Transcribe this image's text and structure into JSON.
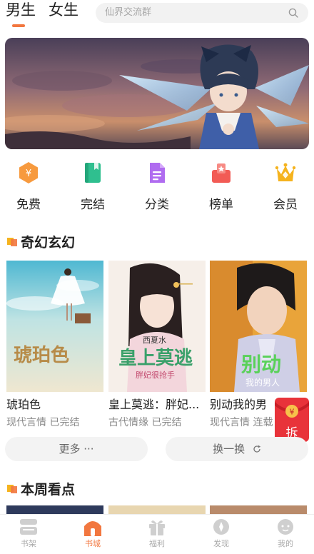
{
  "header": {
    "tabs": [
      {
        "label": "男生",
        "active": true
      },
      {
        "label": "女生",
        "active": false
      }
    ],
    "search": {
      "placeholder": "仙界交流群"
    }
  },
  "quick_links": [
    {
      "label": "免费",
      "icon": "coin-hex-icon",
      "color": "#f79a3e"
    },
    {
      "label": "完结",
      "icon": "book-icon",
      "color": "#2fbf8f"
    },
    {
      "label": "分类",
      "icon": "document-icon",
      "color": "#b06cf0"
    },
    {
      "label": "榜单",
      "icon": "ranking-icon",
      "color": "#f25b55"
    },
    {
      "label": "会员",
      "icon": "crown-icon",
      "color": "#f5b31e"
    }
  ],
  "sections": [
    {
      "title": "奇幻玄幻",
      "books": [
        {
          "title": "琥珀色",
          "meta": "现代言情 已完结",
          "cover_text": "琥珀色"
        },
        {
          "title": "皇上莫逃：胖妃...",
          "meta": "古代情缘 已完结",
          "cover_text": "皇上莫逃",
          "cover_author": "西夏水",
          "cover_sub": "胖妃很抢手"
        },
        {
          "title": "别动我的男",
          "meta": "现代言情 连载",
          "cover_text": "别动",
          "cover_sub": "我的男人"
        }
      ],
      "more_label": "更多 ···",
      "refresh_label": "换一换"
    },
    {
      "title": "本周看点"
    }
  ],
  "float_badge": {
    "label": "拆"
  },
  "bottom_nav": [
    {
      "label": "书架",
      "icon": "bookshelf-icon",
      "active": false
    },
    {
      "label": "书城",
      "icon": "bookstore-icon",
      "active": true
    },
    {
      "label": "福利",
      "icon": "gift-icon",
      "active": false
    },
    {
      "label": "发现",
      "icon": "discover-icon",
      "active": false
    },
    {
      "label": "我的",
      "icon": "profile-icon",
      "active": false
    }
  ],
  "colors": {
    "accent": "#f2773f",
    "float_red": "#e8333a"
  }
}
